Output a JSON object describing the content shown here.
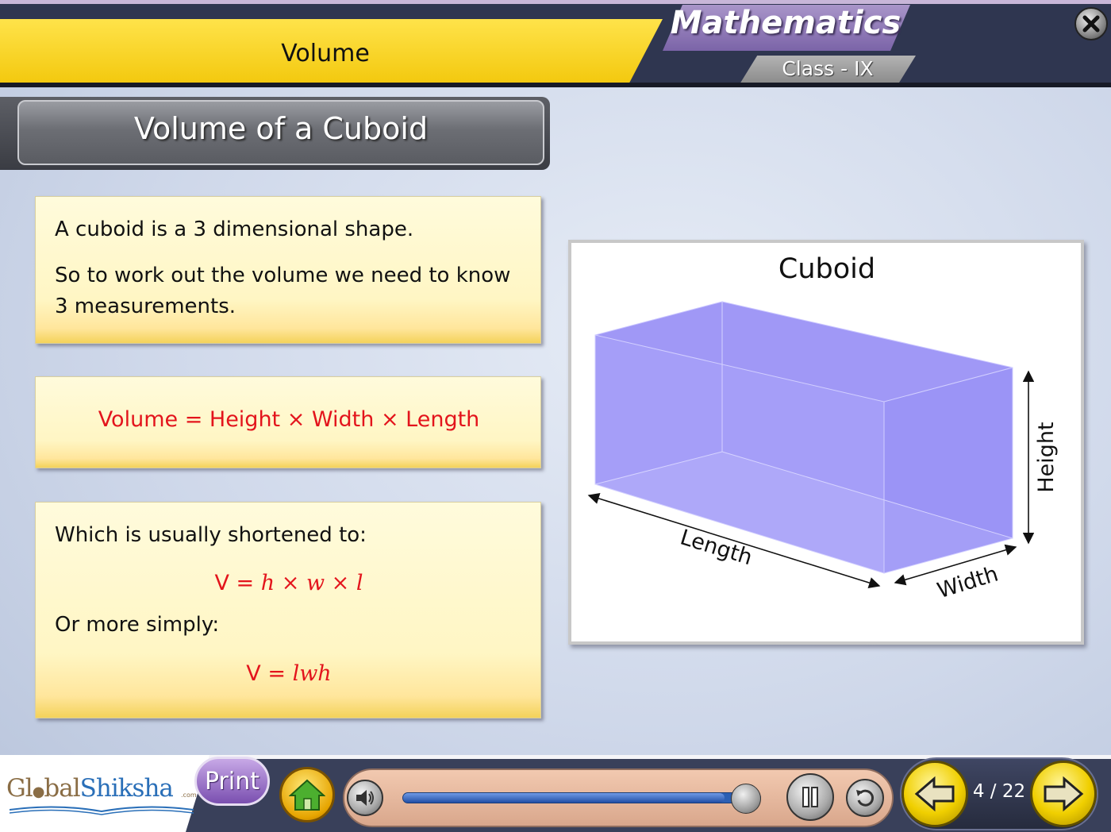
{
  "header": {
    "topic": "Volume",
    "subject": "Mathematics",
    "class_label": "Class - IX"
  },
  "slide": {
    "heading": "Volume of a Cuboid",
    "note1": {
      "line1": "A cuboid is a 3 dimensional shape.",
      "line2": "So to work out the volume we need to know",
      "line3": "3 measurements."
    },
    "note2": {
      "formula": "Volume = Height × Width × Length"
    },
    "note3": {
      "intro": "Which is usually shortened to:",
      "formula1_prefix": "V = ",
      "formula1_vars": "h × w × l",
      "middle": "Or more simply:",
      "formula2_prefix": "V = ",
      "formula2_vars": "lwh"
    }
  },
  "figure": {
    "title": "Cuboid",
    "length_label": "Length",
    "width_label": "Width",
    "height_label": "Height",
    "fill_color": "#8f86f5"
  },
  "footer": {
    "logo_part1": "Gl",
    "logo_part2": "bal",
    "logo_part3": "Shiksha",
    "logo_com": ".com",
    "print_label": "Print",
    "progress_fraction": 0.9,
    "page_indicator": "4 / 22"
  },
  "colors": {
    "formula_red": "#e3141c",
    "header_yellow": "#ffe34a",
    "nav_yellow": "#f0cf00",
    "subject_purple": "#7b64a8"
  },
  "icons": {
    "close": "close-icon",
    "home": "home-icon",
    "audio": "speaker-icon",
    "pause": "pause-icon",
    "replay": "replay-icon",
    "prev": "arrow-left-icon",
    "next": "arrow-right-icon"
  }
}
